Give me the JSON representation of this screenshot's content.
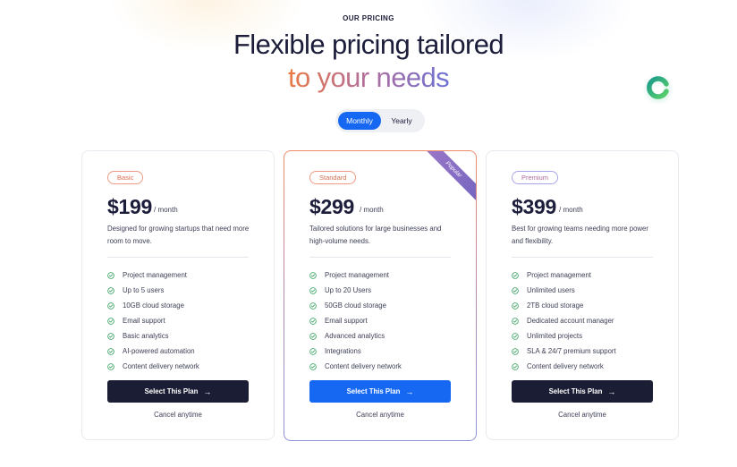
{
  "header": {
    "eyebrow": "OUR PRICING",
    "title_line1": "Flexible pricing tailored",
    "title_line2": "to your needs"
  },
  "billing_toggle": {
    "monthly_label": "Monthly",
    "yearly_label": "Yearly",
    "selected": "Monthly"
  },
  "colors": {
    "accent_blue": "#1668f2",
    "dark_button": "#1b1d34",
    "gradient_orange": "#ea7a45",
    "gradient_purple": "#6e72d4",
    "check_green": "#2e9e5b"
  },
  "plans": [
    {
      "badge": "Basic",
      "price": "$199",
      "period": "/ month",
      "description": "Designed for growing startups that need more room to move.",
      "features": [
        "Project management",
        "Up to 5 users",
        "10GB cloud storage",
        "Email support",
        "Basic analytics",
        "AI-powered automation",
        "Content delivery network"
      ],
      "cta_label": "Select This Plan",
      "cancel_label": "Cancel anytime"
    },
    {
      "badge": "Standard",
      "ribbon": "Popular",
      "price": "$299",
      "period": "/ month",
      "description": "Tailored solutions for large businesses and high-volume needs.",
      "features": [
        "Project management",
        "Up to 20 Users",
        "50GB cloud storage",
        "Email support",
        "Advanced analytics",
        "Integrations",
        "Content delivery network"
      ],
      "cta_label": "Select This Plan",
      "cancel_label": "Cancel anytime"
    },
    {
      "badge": "Premium",
      "price": "$399",
      "period": "/ month",
      "description": "Best for growing teams needing more power and flexibility.",
      "features": [
        "Project management",
        "Unlimited users",
        "2TB cloud storage",
        "Dedicated account manager",
        "Unlimited projects",
        "SLA & 24/7 premium support",
        "Content delivery network"
      ],
      "cta_label": "Select This Plan",
      "cancel_label": "Cancel anytime"
    }
  ],
  "icons": {
    "feature_check": "check-circle-icon",
    "cta_arrow": "arrow-right-icon",
    "brand_logo": "ring-logo-icon"
  }
}
